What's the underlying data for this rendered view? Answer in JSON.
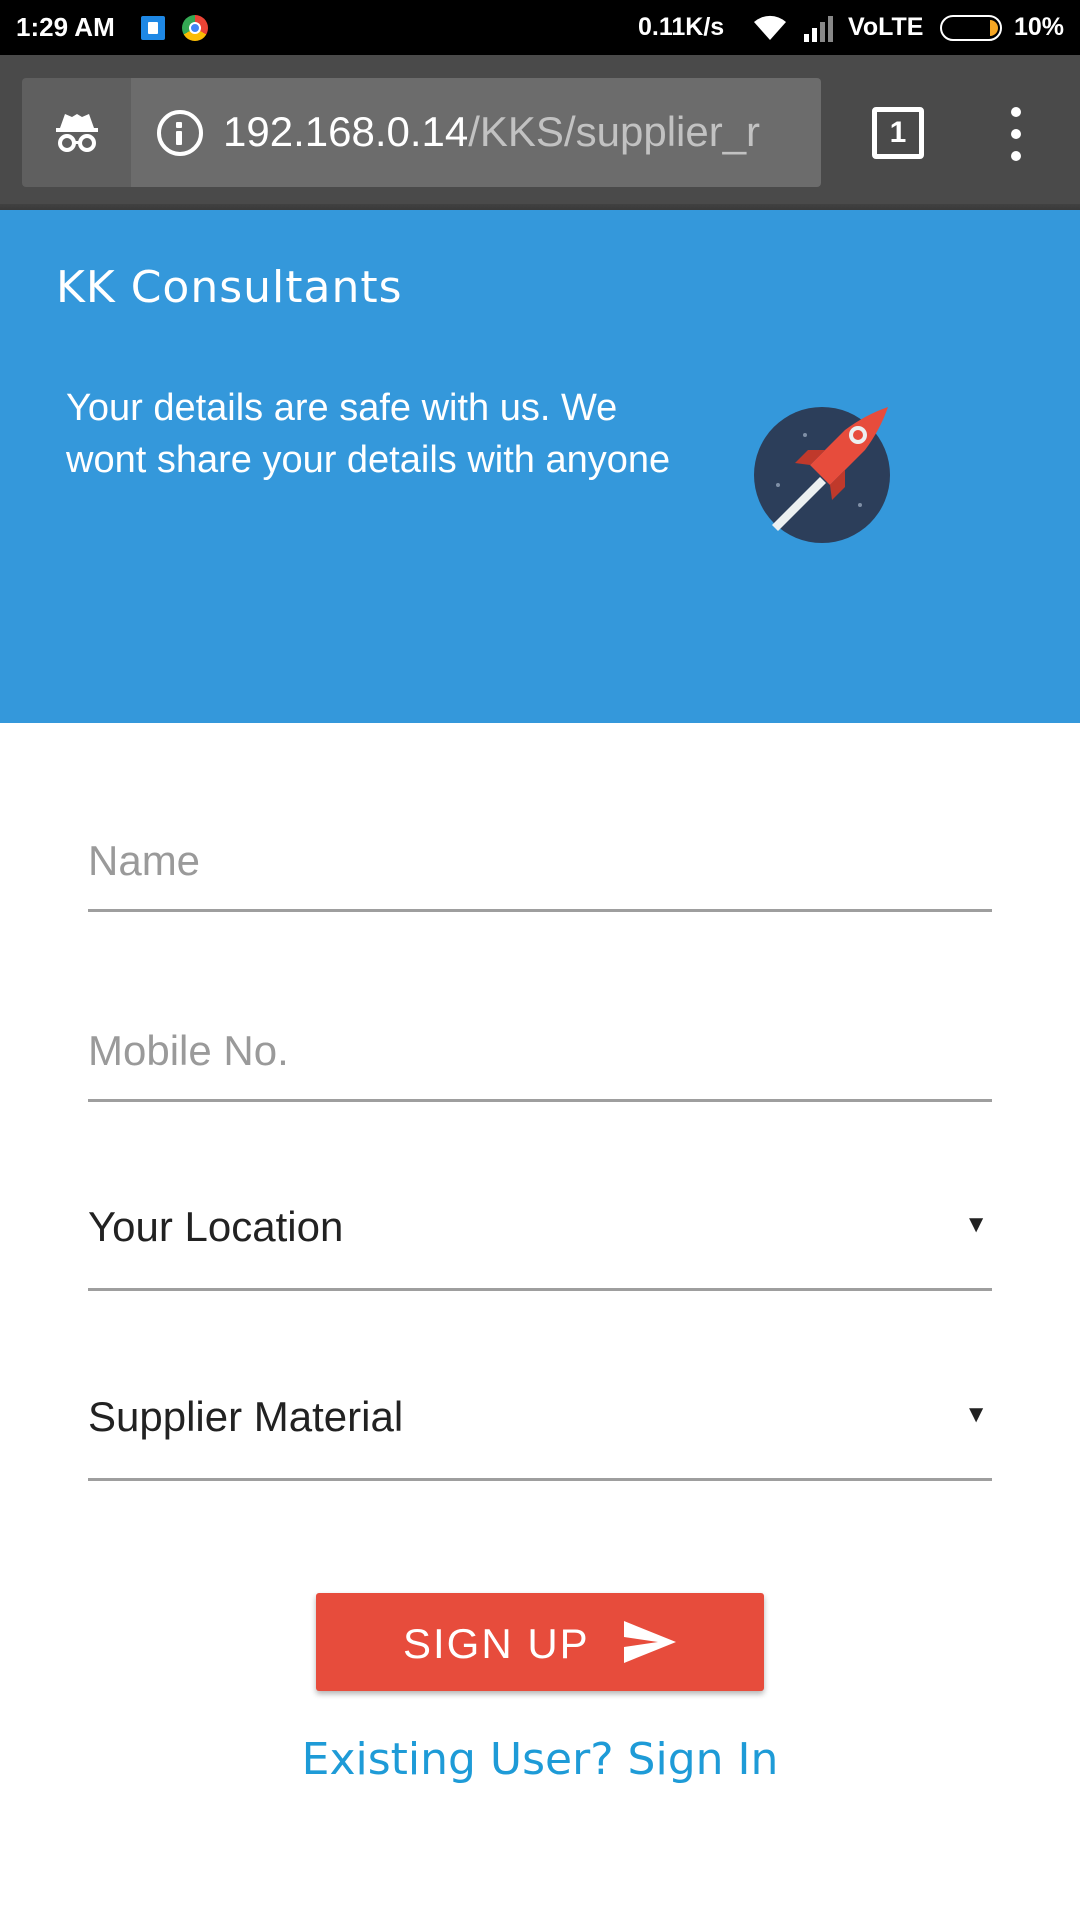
{
  "status_bar": {
    "time": "1:29 AM",
    "speed": "0.11K/s",
    "network": "VoLTE",
    "battery": "10%",
    "icons": [
      "app-notification-icon",
      "chrome-icon",
      "wifi-icon",
      "signal-icon",
      "battery-icon"
    ]
  },
  "browser": {
    "url_host": "192.168.0.14",
    "url_path": "/KKS/supplier_r",
    "tab_count": "1",
    "icons": [
      "incognito-icon",
      "info-icon",
      "tab-switcher-icon",
      "overflow-menu-icon"
    ]
  },
  "hero": {
    "brand": "KK Consultants",
    "message": "Your details are safe with us. We wont share your details with anyone",
    "icon": "rocket-icon",
    "background_color": "#3498db"
  },
  "form": {
    "name_placeholder": "Name",
    "mobile_placeholder": "Mobile No.",
    "location_selected": "Your Location",
    "material_selected": "Supplier Material",
    "caret": "▼",
    "signup_label": "SIGN UP",
    "signup_color": "#e74c3c",
    "signin_link": "Existing User? Sign In",
    "signin_color": "#1e9bd7"
  }
}
